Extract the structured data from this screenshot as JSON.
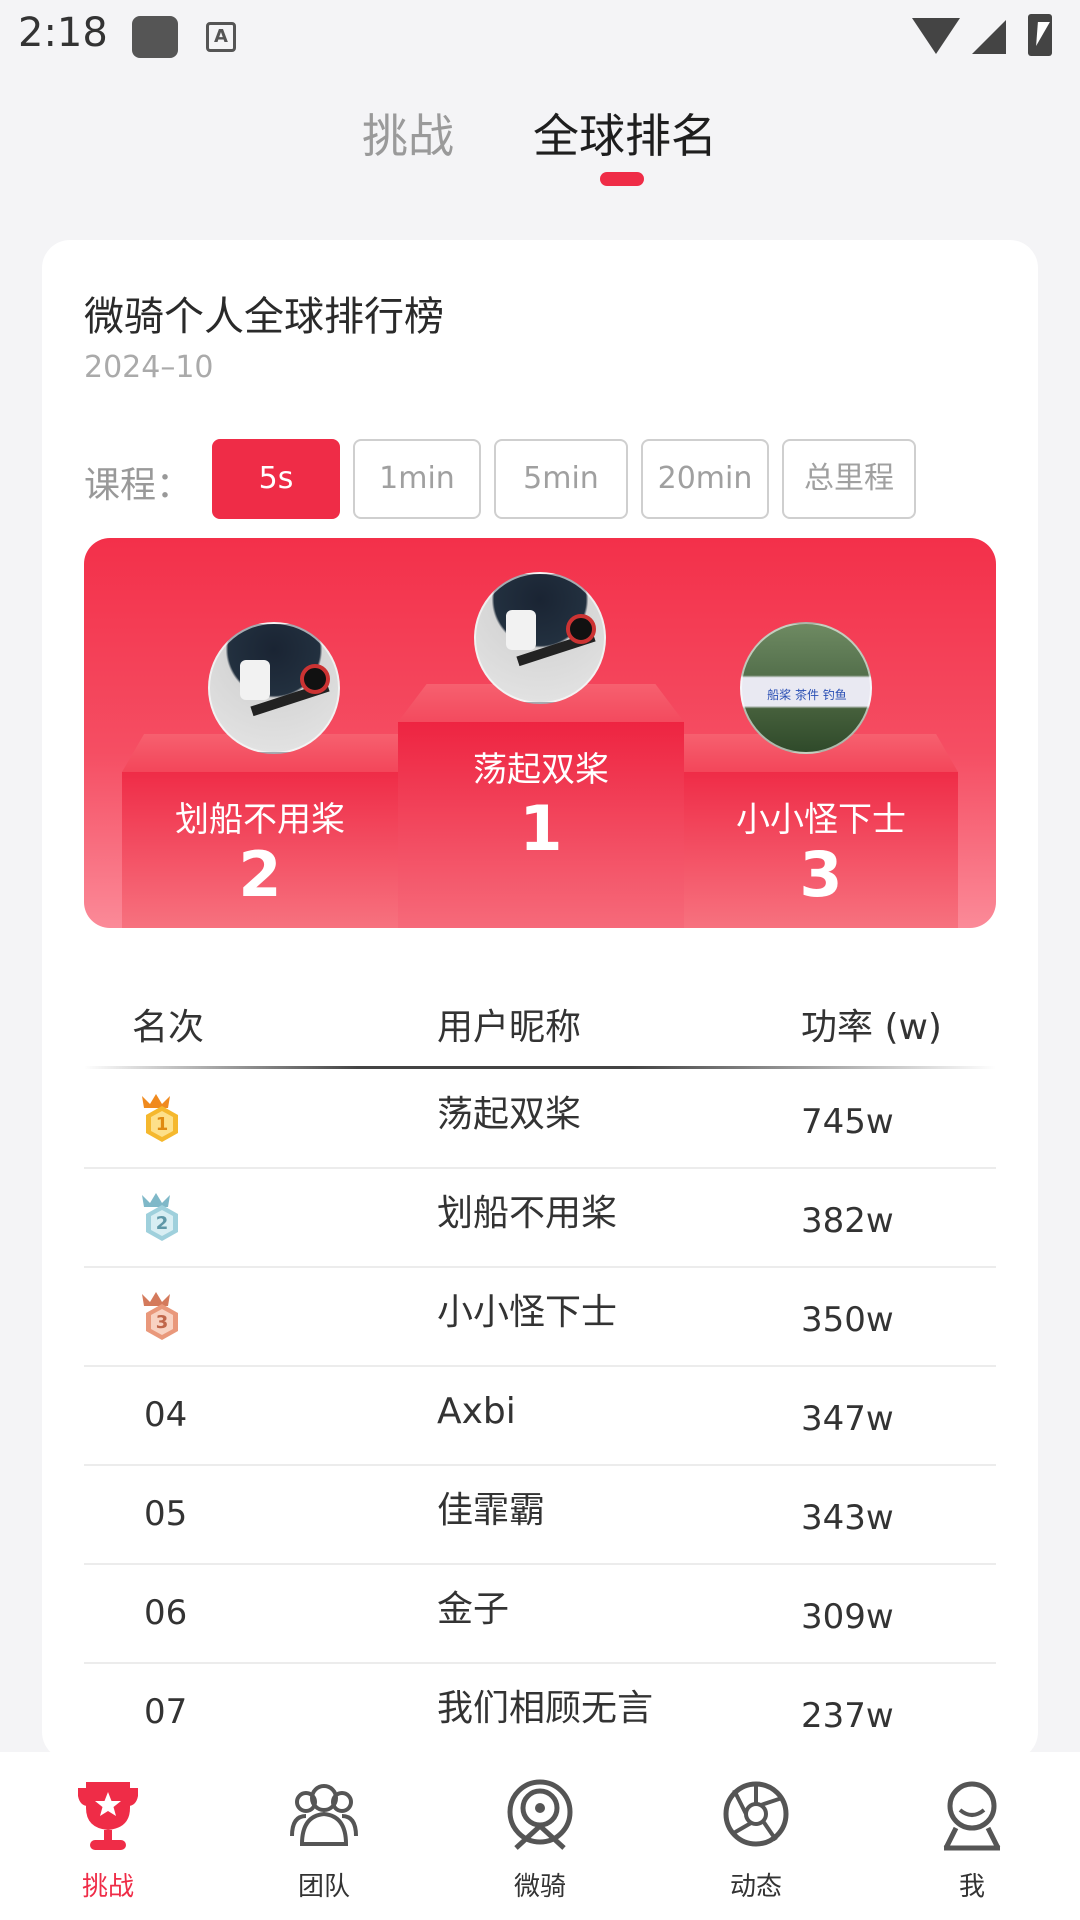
{
  "status_bar": {
    "time": "2:18",
    "a_icon": "A"
  },
  "tabs": {
    "challenge": "挑战",
    "ranking": "全球排名"
  },
  "card": {
    "title": "微骑个人全球排行榜",
    "date": "2024–10",
    "course_label": "课程：",
    "course_options": [
      "5s",
      "1min",
      "5min",
      "20min",
      "总里程"
    ],
    "selected_course": "5s"
  },
  "podium": {
    "first": {
      "name": "荡起双桨",
      "rank": "1"
    },
    "second": {
      "name": "划船不用桨",
      "rank": "2"
    },
    "third": {
      "name": "小小怪下士",
      "rank": "3"
    },
    "third_avatar_sign": "船桨 茶件 钓鱼"
  },
  "table": {
    "headers": {
      "rank": "名次",
      "nickname": "用户昵称",
      "power": "功率 (w)"
    },
    "rows": [
      {
        "rank": "",
        "medal": "1",
        "nickname": "荡起双桨",
        "power": "745w"
      },
      {
        "rank": "",
        "medal": "2",
        "nickname": "划船不用桨",
        "power": "382w"
      },
      {
        "rank": "",
        "medal": "3",
        "nickname": "小小怪下士",
        "power": "350w"
      },
      {
        "rank": "04",
        "medal": "",
        "nickname": "Axbi",
        "power": "347w"
      },
      {
        "rank": "05",
        "medal": "",
        "nickname": "佳霏霸",
        "power": "343w"
      },
      {
        "rank": "06",
        "medal": "",
        "nickname": "金子",
        "power": "309w"
      },
      {
        "rank": "07",
        "medal": "",
        "nickname": "我们相顾无言",
        "power": "237w"
      }
    ]
  },
  "bottom_nav": {
    "items": [
      {
        "label": "挑战",
        "icon": "trophy-icon",
        "active": true
      },
      {
        "label": "团队",
        "icon": "team-icon",
        "active": false
      },
      {
        "label": "微骑",
        "icon": "ride-icon",
        "active": false
      },
      {
        "label": "动态",
        "icon": "aperture-icon",
        "active": false
      },
      {
        "label": "我",
        "icon": "profile-icon",
        "active": false
      }
    ]
  },
  "colors": {
    "accent": "#ef2c47",
    "gold": "#f5b82e",
    "silver": "#9fd0dc",
    "bronze": "#e9987b",
    "nav_icon": "#555555"
  }
}
